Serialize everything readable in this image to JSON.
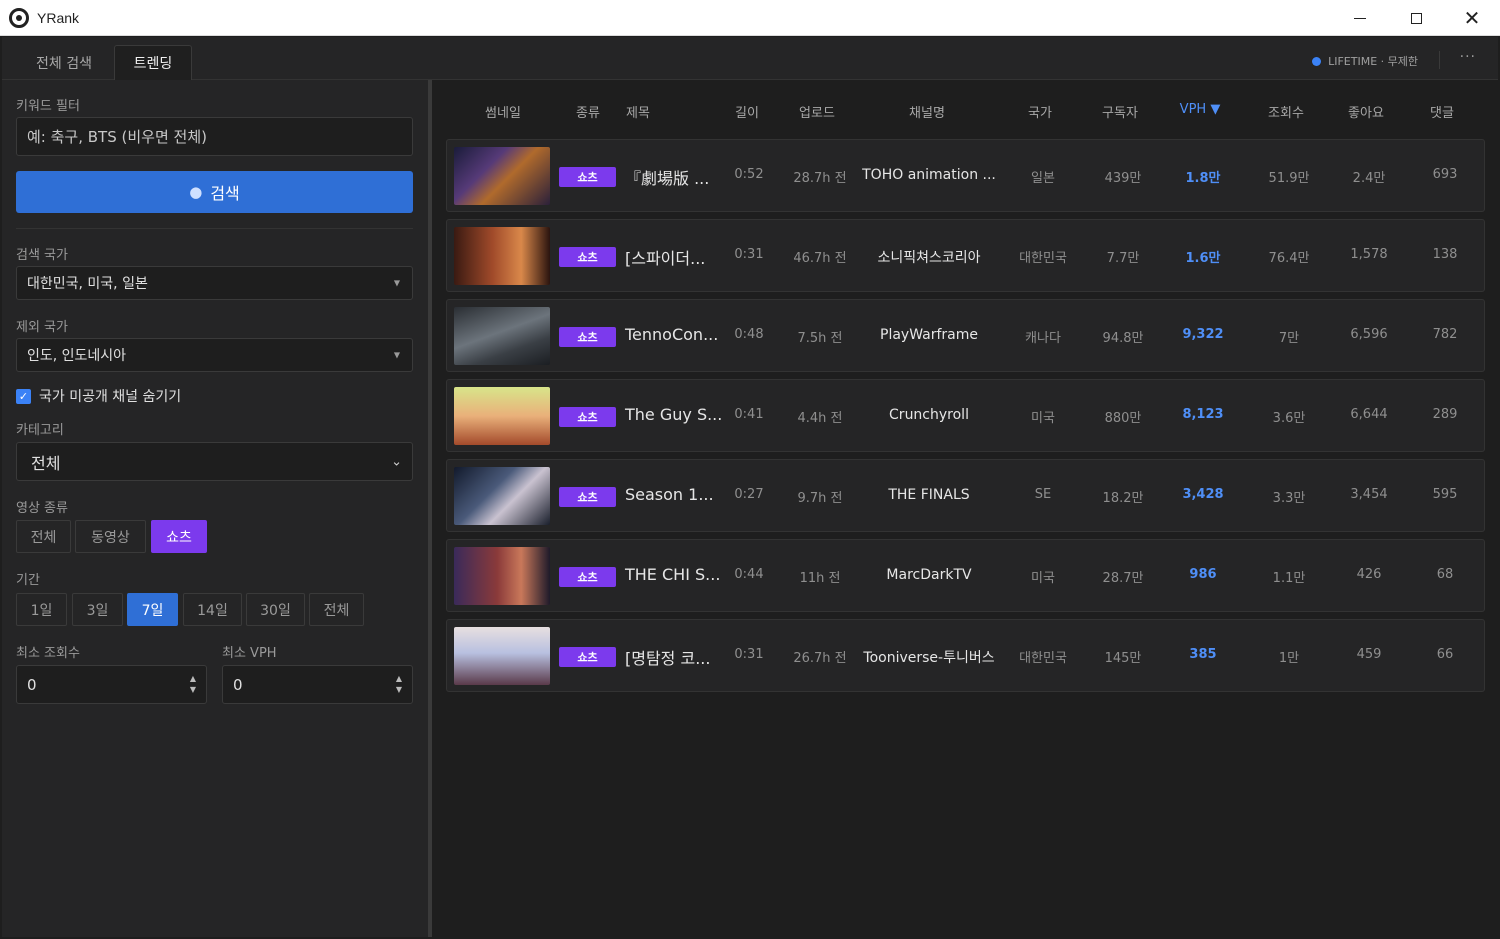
{
  "window": {
    "title": "YRank"
  },
  "tabs": [
    {
      "label": "전체 검색",
      "active": false
    },
    {
      "label": "트렌딩",
      "active": true
    }
  ],
  "license": {
    "text": "LIFETIME · 무제한",
    "color": "#3b82f6"
  },
  "more_label": "···",
  "sidebar": {
    "keyword_label": "키워드 필터",
    "keyword_placeholder": "예: 축구, BTS (비우면 전체)",
    "search_button": "검색",
    "search_country_label": "검색 국가",
    "search_country_value": "대한민국, 미국, 일본",
    "exclude_country_label": "제외 국가",
    "exclude_country_value": "인도, 인도네시아",
    "hide_unlisted_label": "국가 미공개 채널 숨기기",
    "hide_unlisted_checked": true,
    "category_label": "카테고리",
    "category_value": "전체",
    "video_type_label": "영상 종류",
    "video_types": [
      "전체",
      "동영상",
      "쇼츠"
    ],
    "video_type_selected": "쇼츠",
    "period_label": "기간",
    "periods": [
      "1일",
      "3일",
      "7일",
      "14일",
      "30일",
      "전체"
    ],
    "period_selected": "7일",
    "min_views_label": "최소 조회수",
    "min_views_value": "0",
    "min_vph_label": "최소 VPH",
    "min_vph_value": "0"
  },
  "table": {
    "columns": [
      "썸네일",
      "종류",
      "제목",
      "길이",
      "업로드",
      "채널명",
      "국가",
      "구독자",
      "VPH ▼",
      "조회수",
      "좋아요",
      "댓글"
    ],
    "sorted_column": "VPH ▼",
    "rows": [
      {
        "type": "쇼츠",
        "title": "『劇場版 ...",
        "length": "0:52",
        "upload": "28.7h 전",
        "channel": "TOHO animation ...",
        "country": "일본",
        "subs": "439만",
        "vph": "1.8만",
        "views": "51.9만",
        "likes": "2.4만",
        "comments": "693"
      },
      {
        "type": "쇼츠",
        "title": "[스파이더...",
        "length": "0:31",
        "upload": "46.7h 전",
        "channel": "소니픽쳐스코리아",
        "country": "대한민국",
        "subs": "7.7만",
        "vph": "1.6만",
        "views": "76.4만",
        "likes": "1,578",
        "comments": "138"
      },
      {
        "type": "쇼츠",
        "title": "TennoCon...",
        "length": "0:48",
        "upload": "7.5h 전",
        "channel": "PlayWarframe",
        "country": "캐나다",
        "subs": "94.8만",
        "vph": "9,322",
        "views": "7만",
        "likes": "6,596",
        "comments": "782"
      },
      {
        "type": "쇼츠",
        "title": "The Guy S...",
        "length": "0:41",
        "upload": "4.4h 전",
        "channel": "Crunchyroll",
        "country": "미국",
        "subs": "880만",
        "vph": "8,123",
        "views": "3.6만",
        "likes": "6,644",
        "comments": "289"
      },
      {
        "type": "쇼츠",
        "title": "Season 1...",
        "length": "0:27",
        "upload": "9.7h 전",
        "channel": "THE FINALS",
        "country": "SE",
        "subs": "18.2만",
        "vph": "3,428",
        "views": "3.3만",
        "likes": "3,454",
        "comments": "595"
      },
      {
        "type": "쇼츠",
        "title": "THE CHI S...",
        "length": "0:44",
        "upload": "11h 전",
        "channel": "MarcDarkTV",
        "country": "미국",
        "subs": "28.7만",
        "vph": "986",
        "views": "1.1만",
        "likes": "426",
        "comments": "68"
      },
      {
        "type": "쇼츠",
        "title": "[명탐정 코...",
        "length": "0:31",
        "upload": "26.7h 전",
        "channel": "Tooniverse-투니버스",
        "country": "대한민국",
        "subs": "145만",
        "vph": "385",
        "views": "1만",
        "likes": "459",
        "comments": "66"
      }
    ]
  }
}
